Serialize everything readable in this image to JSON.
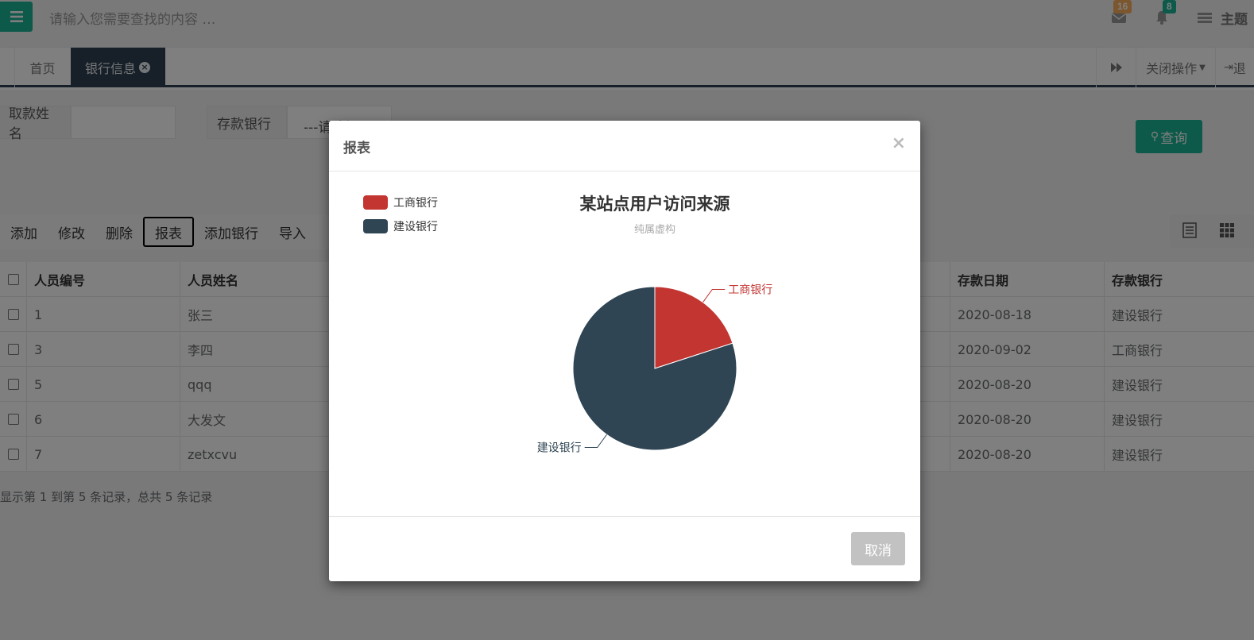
{
  "topbar": {
    "search_placeholder": "请输入您需要查找的内容 …",
    "mail_count": "16",
    "bell_count": "8",
    "theme_label": "主题",
    "colors": {
      "accent": "#1ab394",
      "mail_badge": "#f8ac59",
      "bell_badge": "#1ab394"
    }
  },
  "tabs": {
    "home_label": "首页",
    "active_label": "银行信息",
    "close_ops_label": "关闭操作",
    "logout_label": "退"
  },
  "search_form": {
    "name_label": "取款姓名",
    "bank_label": "存款银行",
    "bank_select_value": "---请选择",
    "query_label": "查询"
  },
  "toolbar": {
    "buttons": [
      "添加",
      "修改",
      "删除",
      "报表",
      "添加银行",
      "导入"
    ]
  },
  "table": {
    "headers": [
      "人员编号",
      "人员姓名",
      "存款日期",
      "存款银行"
    ],
    "rows": [
      {
        "id": "1",
        "name": "张三",
        "date": "2020-08-18",
        "bank": "建设银行"
      },
      {
        "id": "3",
        "name": "李四",
        "date": "2020-09-02",
        "bank": "工商银行"
      },
      {
        "id": "5",
        "name": "qqq",
        "date": "2020-08-20",
        "bank": "建设银行"
      },
      {
        "id": "6",
        "name": "大发文",
        "date": "2020-08-20",
        "bank": "建设银行"
      },
      {
        "id": "7",
        "name": "zetxcvu",
        "date": "2020-08-20",
        "bank": "建设银行"
      }
    ],
    "pager_text": "显示第 1 到第 5 条记录，总共 5 条记录"
  },
  "modal": {
    "title": "报表",
    "close_symbol": "×",
    "cancel_label": "取消"
  },
  "chart_data": {
    "type": "pie",
    "title": "某站点用户访问来源",
    "subtitle": "纯属虚构",
    "legend_position": "top-left",
    "categories": [
      "工商银行",
      "建设银行"
    ],
    "values": [
      1,
      4
    ],
    "colors": [
      "#c23531",
      "#2f4554"
    ]
  }
}
